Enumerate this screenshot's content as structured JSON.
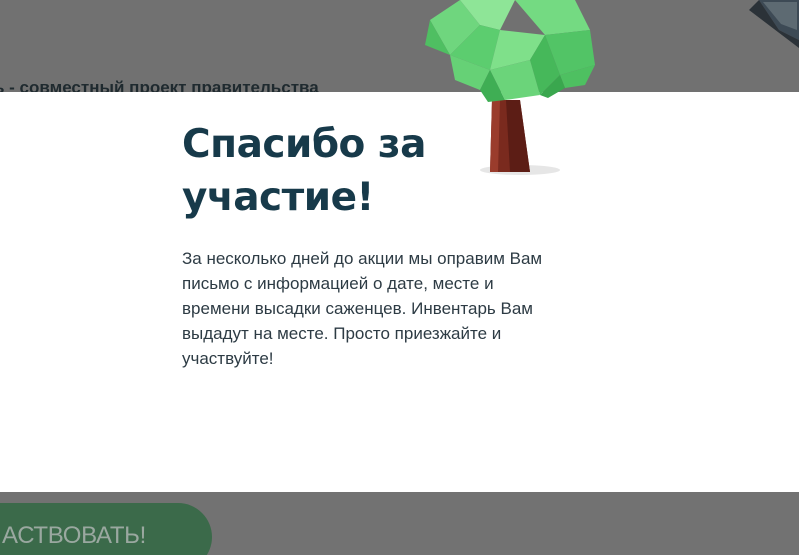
{
  "background": {
    "partial_heading": "ь - совместный проект правительства",
    "cta_button_label": "АСТВОВАТЬ!"
  },
  "modal": {
    "title_line1": "Спасибо за",
    "title_line2": "участие!",
    "text_line1": "За несколько дней до акции мы оправим Вам",
    "text_line2": "письмо с информацией о дате, месте и",
    "text_line3": "времени высадки саженцев. Инвентарь Вам",
    "text_line4": "выдадут на месте. Просто приезжайте и",
    "text_line5": "участвуйте!",
    "illustration": "tree-icon"
  },
  "colors": {
    "overlay": "#757575",
    "modal_bg": "#ffffff",
    "title": "#173a4a",
    "body_text": "#2d3b44",
    "tree_leaves": "#6fd67e",
    "tree_trunk": "#7a2a1e",
    "cta_bg": "#3b6a4a"
  }
}
